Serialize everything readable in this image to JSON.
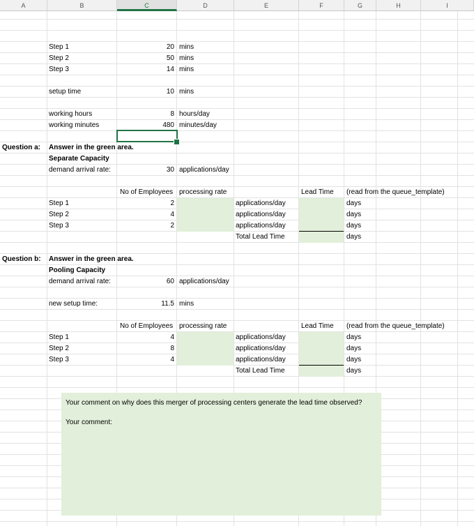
{
  "columns": [
    "A",
    "B",
    "C",
    "D",
    "E",
    "F",
    "G",
    "H",
    "I"
  ],
  "steps": {
    "labels": [
      "Step 1",
      "Step 2",
      "Step 3"
    ],
    "values": [
      "20",
      "50",
      "14"
    ],
    "unit": "mins"
  },
  "setup": {
    "label": "setup time",
    "value": "10",
    "unit": "mins"
  },
  "working": {
    "hours_label": "working hours",
    "hours_value": "8",
    "hours_unit": "hours/day",
    "minutes_label": "working minutes",
    "minutes_value": "480",
    "minutes_unit": "minutes/day"
  },
  "qa": {
    "label": "Question a:",
    "instruction": "Answer in the green area.",
    "heading": "Separate Capacity",
    "demand_label": "demand arrival rate:",
    "demand_value": "30",
    "demand_unit": "applications/day",
    "col_employees": "No of Employees",
    "col_rate": "processing rate",
    "col_lead": "Lead Time",
    "col_note": "(read from the queue_template)",
    "step_labels": [
      "Step 1",
      "Step 2",
      "Step 3"
    ],
    "employees": [
      "2",
      "4",
      "2"
    ],
    "rate_units": [
      "applications/day",
      "applications/day",
      "applications/day"
    ],
    "total_label": "Total Lead Time",
    "lead_units": [
      "days",
      "days",
      "days",
      "days"
    ]
  },
  "qb": {
    "label": "Question b:",
    "instruction": "Answer in the green area.",
    "heading": "Pooling Capacity",
    "demand_label": "demand arrival rate:",
    "demand_value": "60",
    "demand_unit": "applications/day",
    "setup_label": "new setup time:",
    "setup_value": "11.5",
    "setup_unit": "mins",
    "col_employees": "No of Employees",
    "col_rate": "processing rate",
    "col_lead": "Lead Time",
    "col_note": "(read from the queue_template)",
    "step_labels": [
      "Step 1",
      "Step 2",
      "Step 3"
    ],
    "employees": [
      "4",
      "8",
      "4"
    ],
    "rate_units": [
      "applications/day",
      "applications/day",
      "applications/day"
    ],
    "total_label": "Total Lead Time",
    "lead_units": [
      "days",
      "days",
      "days",
      "days"
    ]
  },
  "comment": {
    "question": "Your comment on why does this merger of processing centers generate the lead time observed?",
    "label": "Your comment:"
  },
  "colors": {
    "green_fill": "#e2efda",
    "accent": "#217346"
  }
}
